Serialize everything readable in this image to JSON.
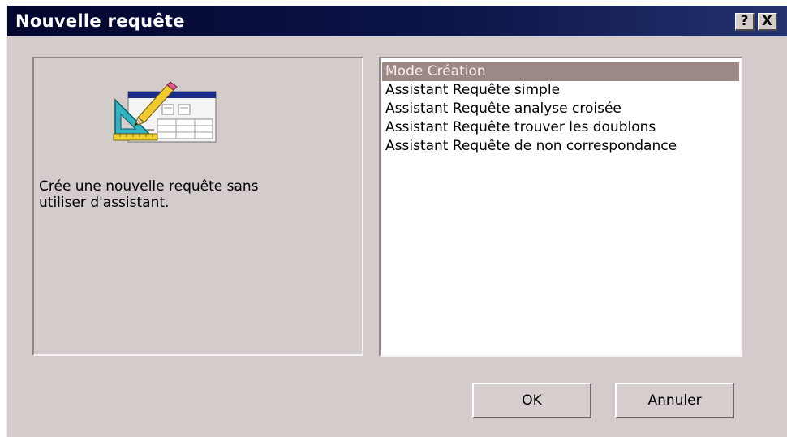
{
  "window": {
    "title": "Nouvelle requête",
    "help_label": "?",
    "close_label": "X"
  },
  "left_panel": {
    "icon": "query-design-icon",
    "description": "Crée une nouvelle requête sans\nutiliser d'assistant."
  },
  "list": {
    "selected_index": 0,
    "items": [
      {
        "label": "Mode Création"
      },
      {
        "label": "Assistant Requête simple"
      },
      {
        "label": "Assistant Requête analyse croisée"
      },
      {
        "label": "Assistant Requête trouver les doublons"
      },
      {
        "label": "Assistant Requête de non correspondance"
      }
    ]
  },
  "buttons": {
    "ok_label": "OK",
    "cancel_label": "Annuler"
  },
  "colors": {
    "title_bar": "#0b1447",
    "dialog_face": "#d4cccb",
    "selection": "#9c8884"
  }
}
